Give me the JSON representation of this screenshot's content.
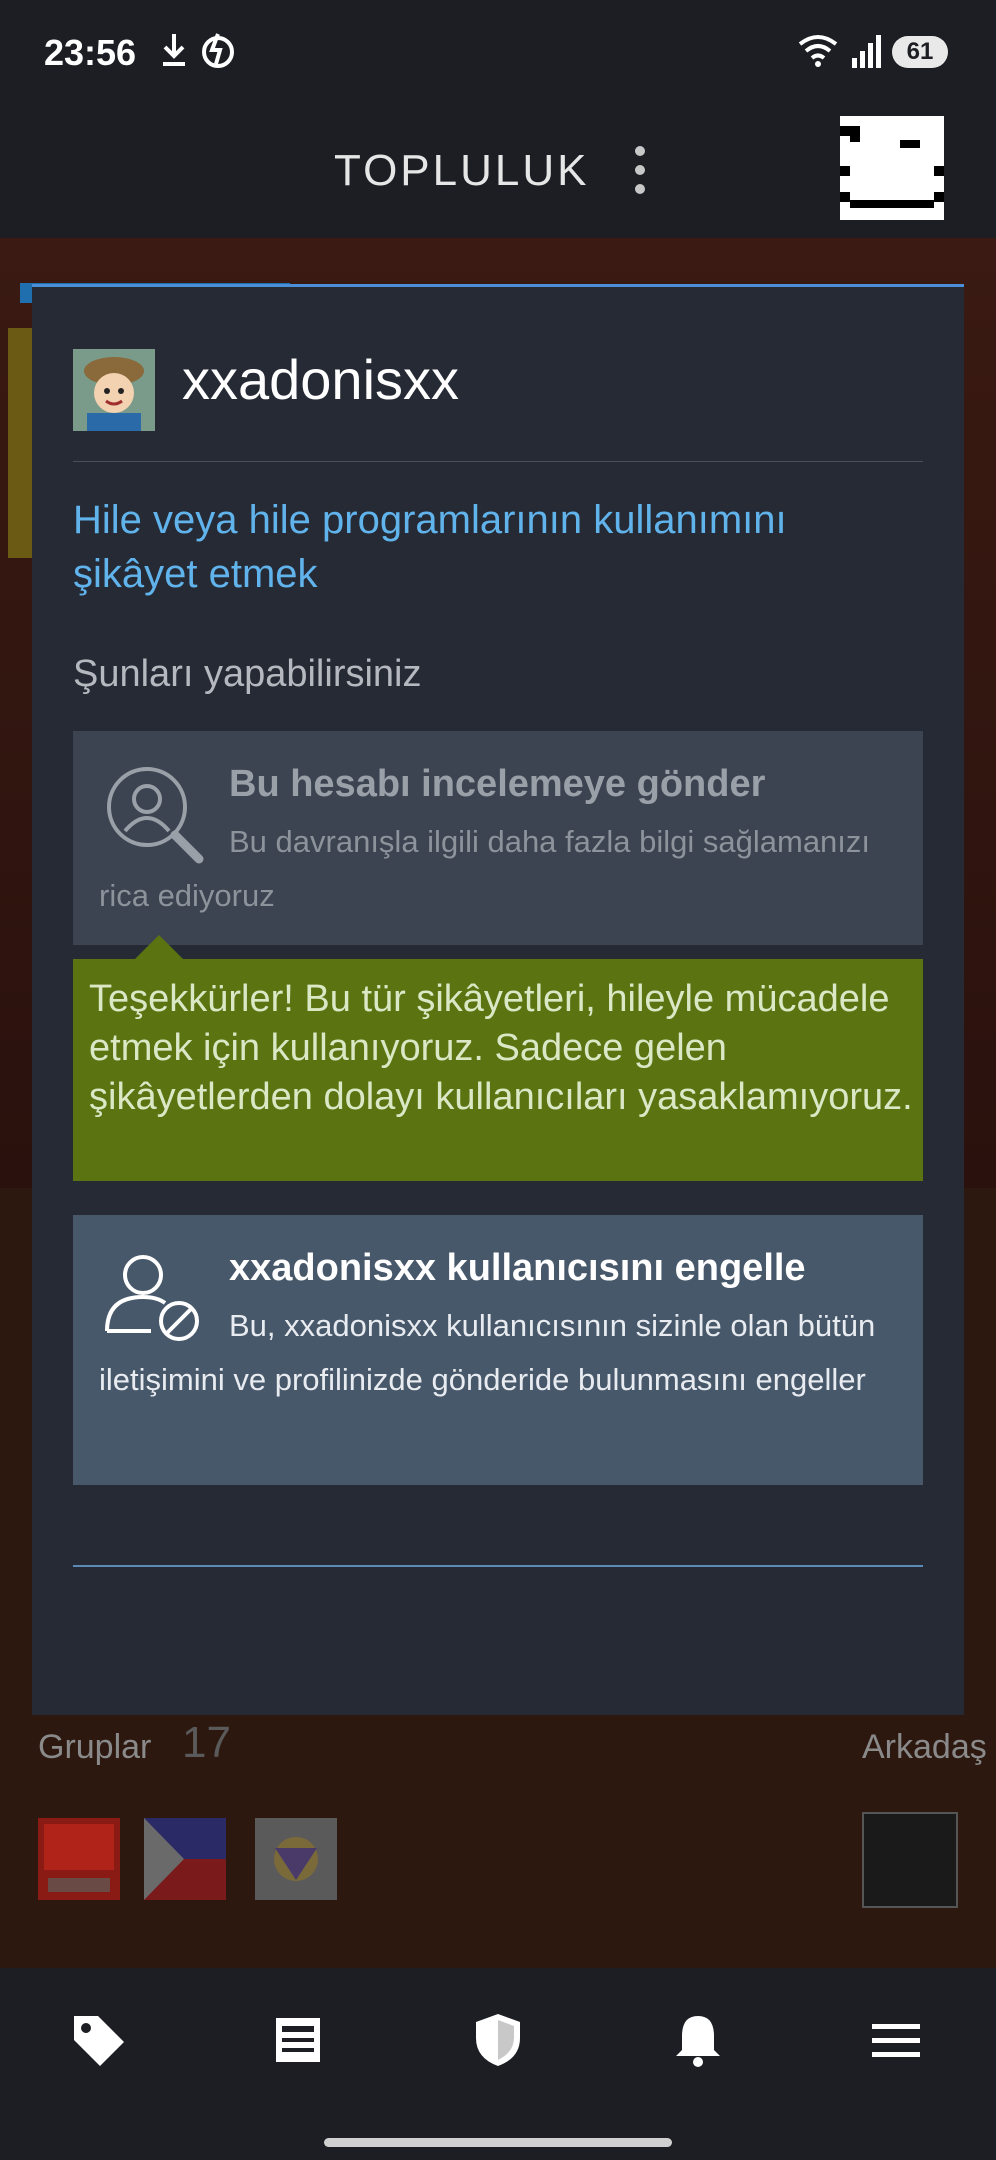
{
  "status_bar": {
    "time": "23:56",
    "battery": "61"
  },
  "header": {
    "title": "TOPLULUK"
  },
  "background_profile": {
    "groups_label": "Gruplar",
    "groups_count": "17",
    "friends_label": "Arkadaş"
  },
  "modal": {
    "username": "xxadonisxx",
    "report_link": "Hile veya hile programlarının kullanımını şikâyet etmek",
    "section_label": "Şunları yapabilirsiniz",
    "review_card": {
      "title": "Bu hesabı incelemeye gönder",
      "description": "Bu davranışla ilgili daha fazla bilgi sağlamanızı rica ediyoruz"
    },
    "thanks_message": "Teşekkürler! Bu tür şikâyetleri, hileyle mücadele etmek için kullanıyoruz. Sadece gelen şikâyetlerden dolayı kullanıcıları yasaklamıyoruz.",
    "block_card": {
      "title": "xxadonisxx kullanıcısını engelle",
      "description": "Bu, xxadonisxx kullanıcısının sizinle olan bütün iletişimini ve profilinizde gönderide bulunmasını engeller"
    }
  },
  "bottom_nav": {
    "items": [
      {
        "icon": "tag-icon"
      },
      {
        "icon": "news-icon"
      },
      {
        "icon": "shield-icon"
      },
      {
        "icon": "bell-icon"
      },
      {
        "icon": "menu-icon"
      }
    ]
  }
}
